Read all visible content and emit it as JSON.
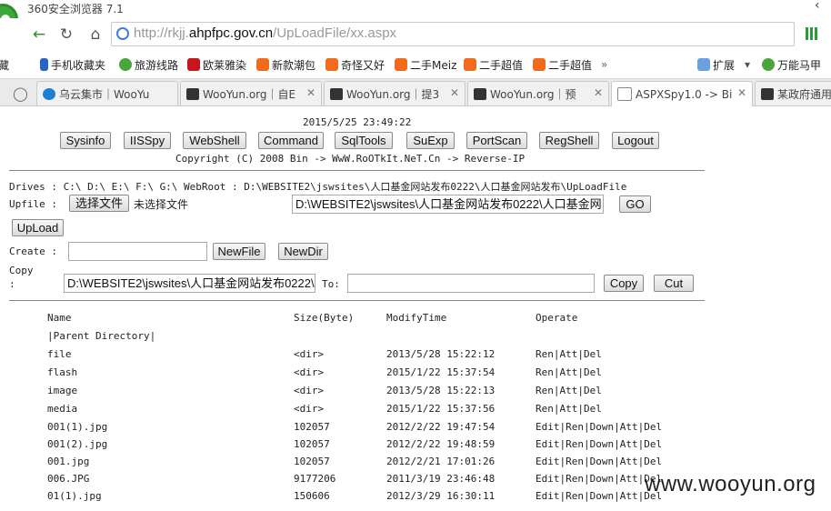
{
  "browser": {
    "title": "360安全浏览器 7.1",
    "url_prefix": "http://rkjj.",
    "url_host": "ahpfpc.gov.cn",
    "url_path": "/UpLoadFile/xx.aspx",
    "bookmarks": [
      "藏",
      "手机收藏夹",
      "旅游线路",
      "欧莱雅染",
      "新款潮包",
      "奇怪又好",
      "二手Meiz",
      "二手超值",
      "二手超值"
    ],
    "more": "»",
    "extend": "扩展",
    "right_bookmark": "万能马甲",
    "tabs": [
      "乌云集市｜WooYu",
      "WooYun.org｜自E",
      "WooYun.org｜提3",
      "WooYun.org｜预",
      "ASPXSpy1.0 -> Bi",
      "某政府通用"
    ],
    "active_tab": 4
  },
  "spy": {
    "datetime": "2015/5/25 23:49:22",
    "nav_buttons": [
      "Sysinfo",
      "IISSpy",
      "WebShell",
      "Command",
      "SqlTools",
      "SuExp",
      "PortScan",
      "RegShell",
      "Logout"
    ],
    "copyright": "Copyright (C) 2008 Bin -> WwW.RoOTkIt.NeT.Cn -> Reverse-IP",
    "drives_line": "Drives : C:\\ D:\\ E:\\ F:\\ G:\\  WebRoot : D:\\WEBSITE2\\jswsites\\人口基金网站发布0222\\人口基金网站发布\\UpLoadFile",
    "upfile_label": "Upfile :",
    "choose_file": "选择文件",
    "no_file": "未选择文件",
    "path_value": "D:\\WEBSITE2\\jswsites\\人口基金网站发布0222\\人口基金网",
    "go": "GO",
    "upload": "UpLoad",
    "create_label": "Create :",
    "newfile": "NewFile",
    "newdir": "NewDir",
    "copy_label_1": "Copy",
    "copy_label_2": ":",
    "copy_src": "D:\\WEBSITE2\\jswsites\\人口基金网站发布0222\\",
    "to_label": "To:",
    "copy_btn": "Copy",
    "cut_btn": "Cut",
    "columns": [
      "Name",
      "Size(Byte)",
      "ModifyTime",
      "Operate"
    ],
    "parent": "|Parent Directory|",
    "rows": [
      {
        "name": "file",
        "size": "<dir>",
        "time": "2013/5/28 15:22:12",
        "op": "Ren|Att|Del"
      },
      {
        "name": "flash",
        "size": "<dir>",
        "time": "2015/1/22 15:37:54",
        "op": "Ren|Att|Del"
      },
      {
        "name": "image",
        "size": "<dir>",
        "time": "2013/5/28 15:22:13",
        "op": "Ren|Att|Del"
      },
      {
        "name": "media",
        "size": "<dir>",
        "time": "2015/1/22 15:37:56",
        "op": "Ren|Att|Del"
      },
      {
        "name": "001(1).jpg",
        "size": "102057",
        "time": "2012/2/22 19:47:54",
        "op": "Edit|Ren|Down|Att|Del"
      },
      {
        "name": "001(2).jpg",
        "size": "102057",
        "time": "2012/2/22 19:48:59",
        "op": "Edit|Ren|Down|Att|Del"
      },
      {
        "name": "001.jpg",
        "size": "102057",
        "time": "2012/2/21 17:01:26",
        "op": "Edit|Ren|Down|Att|Del"
      },
      {
        "name": "006.JPG",
        "size": "9177206",
        "time": "2011/3/19 23:46:48",
        "op": "Edit|Ren|Down|Att|Del"
      },
      {
        "name": "01(1).jpg",
        "size": "150606",
        "time": "2012/3/29 16:30:11",
        "op": "Edit|Ren|Down|Att|Del"
      }
    ]
  },
  "watermark": "www.wooyun.org"
}
